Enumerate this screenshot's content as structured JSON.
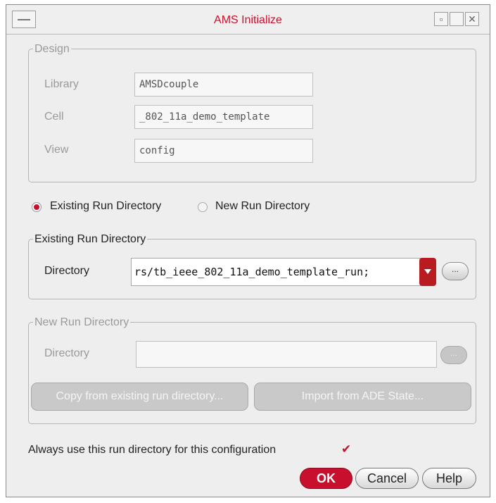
{
  "window": {
    "title": "AMS Initialize"
  },
  "design": {
    "legend": "Design",
    "library_label": "Library",
    "library_value": "AMSDcouple",
    "cell_label": "Cell",
    "cell_value": "_802_11a_demo_template",
    "view_label": "View",
    "view_value": "config"
  },
  "mode": {
    "existing_label": "Existing Run Directory",
    "new_label": "New Run Directory",
    "selected": "existing"
  },
  "existing": {
    "legend": "Existing Run Directory",
    "directory_label": "Directory",
    "directory_value": "rs/tb_ieee_802_11a_demo_template_run;",
    "browse_label": "..."
  },
  "new_dir": {
    "legend": "New Run Directory",
    "directory_label": "Directory",
    "directory_value": "",
    "browse_label": "...",
    "copy_label": "Copy from existing run directory...",
    "import_label": "Import from ADE State..."
  },
  "always_use": {
    "label": "Always use this run directory for this configuration",
    "checked": true,
    "mark": "✔"
  },
  "buttons": {
    "ok": "OK",
    "cancel": "Cancel",
    "help": "Help"
  },
  "colors": {
    "accent": "#c8102e"
  },
  "icons": {
    "minimize": "minimize-icon",
    "maximize": "maximize-icon",
    "close": "close-icon",
    "menu": "window-menu-icon"
  },
  "titlebar": {
    "minimize_glyph": "▫",
    "close_glyph": "✕"
  }
}
